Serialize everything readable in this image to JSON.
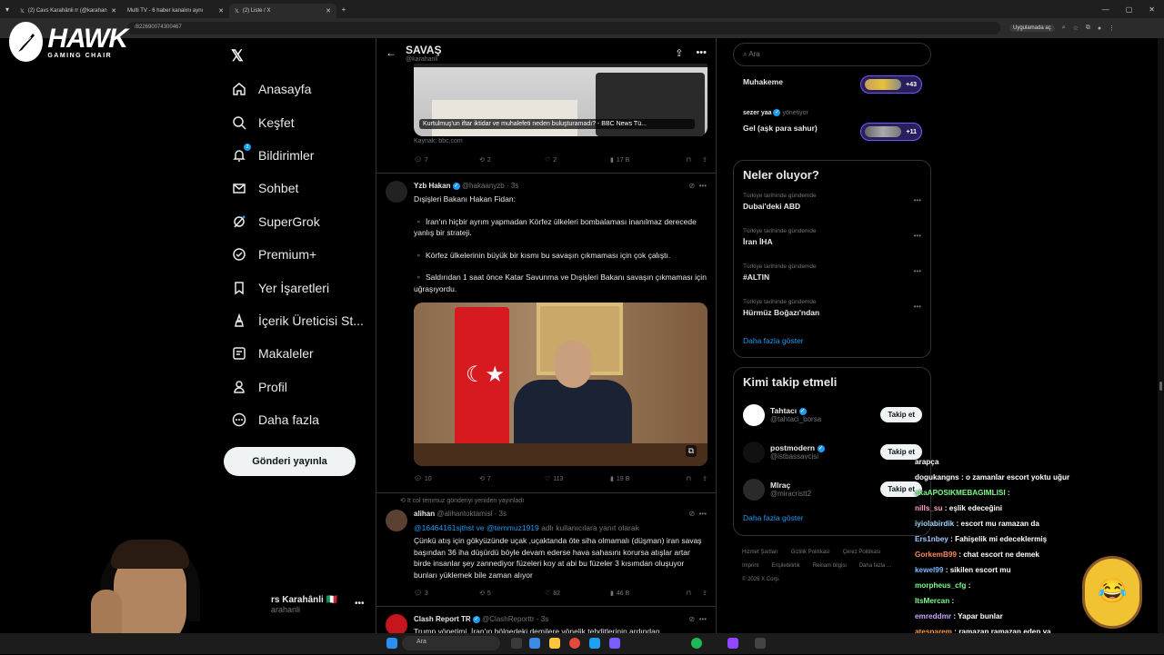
{
  "browser": {
    "tabs": [
      {
        "title": "(2) Cavs Karahânli rr (@karahan",
        "active": false
      },
      {
        "title": "Multi TV - 6 haber kanalını aynı",
        "active": false
      },
      {
        "title": "(2) Liste / X",
        "active": true
      }
    ],
    "url": "/822690074300467",
    "open_in_app": "Uygulamada aç"
  },
  "overlay_logo": {
    "title": "HAWK",
    "subtitle": "GAMING CHAIR"
  },
  "sidebar": {
    "items": [
      {
        "label": "Anasayfa",
        "icon": "home-icon"
      },
      {
        "label": "Keşfet",
        "icon": "search-icon"
      },
      {
        "label": "Bildirimler",
        "icon": "bell-icon",
        "badge": "2"
      },
      {
        "label": "Sohbet",
        "icon": "mail-icon"
      },
      {
        "label": "SuperGrok",
        "icon": "grok-icon"
      },
      {
        "label": "Premium+",
        "icon": "verified-icon"
      },
      {
        "label": "Yer İşaretleri",
        "icon": "bookmark-icon"
      },
      {
        "label": "İçerik Üreticisi St...",
        "icon": "creator-icon"
      },
      {
        "label": "Makaleler",
        "icon": "article-icon"
      },
      {
        "label": "Profil",
        "icon": "person-icon"
      },
      {
        "label": "Daha fazla",
        "icon": "more-circle-icon"
      }
    ],
    "post_button": "Gönderi yayınla",
    "profile_name": "rs Karahânli 🇮🇹",
    "profile_handle": "arahanli"
  },
  "feed": {
    "title": "SAVAŞ",
    "subtitle": "@karahanli",
    "card": {
      "caption": "Kurtulmuş'un iftar iktidar ve muhalefeti neden buluşturamadı? - BBC News Tü...",
      "source": "Kaynak: bbc.com",
      "replies": "7",
      "reposts": "2",
      "likes": "2",
      "views": "17 B"
    },
    "tweets": [
      {
        "name": "Yzb Hakan",
        "handle": "@hakaanyzb",
        "time": "3s",
        "lines": [
          "Dışişleri Bakanı Hakan Fidan:",
          "▪️ İran'ın hiçbir ayrım yapmadan Körfez ülkeleri bombalaması inanılmaz derecede yanlış bir strateji.",
          "▪️ Körfez ülkelerinin büyük bir kısmı bu savaşın çıkmaması için çok çalıştı.",
          "▪️ Saldırıdan 1 saat önce Katar Savunma ve Dışişleri Bakanı savaşın çıkmaması için uğraşıyordu."
        ],
        "replies": "10",
        "reposts": "7",
        "likes": "113",
        "views": "19 B"
      },
      {
        "repost_note": "It col temmuz gönderiyi yeniden yayınladı",
        "name": "alihan",
        "handle": "@alihantoktamisl",
        "time": "3s",
        "reply_to": "@16464161sjthst ve @temmuz1919",
        "reply_suffix": "adlı kullanıcılara yanıt olarak",
        "text": "Çünkü atış için gökyüzünde uçak ,uçaktanda öte siha olmamalı (düşman) iran savaş başından 36 iha düşürdü böyle devam ederse hava sahasını korursa atışlar artar birde insanlar şey zannediyor füzeleri koy at abi bu füzeler 3 kısımdan oluşuyor bunları yüklemek bile zaman alıyor",
        "replies": "3",
        "reposts": "5",
        "likes": "82",
        "views": "46 B"
      },
      {
        "name": "Clash Report TR",
        "handle": "@ClashReporttr",
        "time": "3s",
        "text": "Trump yönetimi, İran'ın bölgedeki demilere yönelik tehditlerinin ardından"
      }
    ]
  },
  "right": {
    "search_placeholder": "Ara",
    "spaces": [
      {
        "name": "Muhakeme",
        "count": "+43"
      },
      {
        "host": "sezer yaa",
        "host_role": "yönetiyor",
        "name": "Gel (aşk para sahur)",
        "count": "+11"
      }
    ],
    "trends_title": "Neler oluyor?",
    "trends": [
      {
        "context": "Türkiye tarihinde gündemde",
        "name": "Dubai'deki ABD"
      },
      {
        "context": "Türkiye tarihinde gündemde",
        "name": "İran İHA"
      },
      {
        "context": "Türkiye tarihinde gündemde",
        "name": "#ALTIN"
      },
      {
        "context": "Türkiye tarihinde gündemde",
        "name": "Hürmüz Boğazı'ndan"
      }
    ],
    "show_more": "Daha fazla göster",
    "who_title": "Kimi takip etmeli",
    "who": [
      {
        "name": "Tahtacı",
        "handle": "@tahtaci_borsa"
      },
      {
        "name": "postmodern",
        "handle": "@istbassavcisi"
      },
      {
        "name": "Mlraç",
        "handle": "@miracristt2"
      }
    ],
    "follow_label": "Takip et",
    "footer": [
      "Hizmet Şartları",
      "Gizlilik Politikası",
      "Çerez Politikası",
      "Imprint",
      "Erişilebilirlik",
      "Reklam bilgisi",
      "Daha fazla ...",
      "© 2026 X Corp."
    ]
  },
  "chat": [
    {
      "user": "",
      "msg": "arapça"
    },
    {
      "user": "dogukangns",
      "msg": ": o zamanlar escort yoktu uğur"
    },
    {
      "user": "akaAPOSIKMEBAGIMLISI",
      "msg": ":"
    },
    {
      "user": "nills_su",
      "msg": ": eşlik edeceğini"
    },
    {
      "user": "iyiolabirdik",
      "msg": ": escort mu ramazan da"
    },
    {
      "user": "Ers1nbey",
      "msg": ": Fahişelik mi edeceklermiş"
    },
    {
      "user": "GorkemB99",
      "msg": ": chat escort ne demek"
    },
    {
      "user": "kewel99",
      "msg": ": sikilen escort mu"
    },
    {
      "user": "morpheus_cfg",
      "msg": ":"
    },
    {
      "user": "ItsMercan",
      "msg": ":"
    },
    {
      "user": "emreddmr",
      "msg": ": Yapar bunlar"
    },
    {
      "user": "atesparem",
      "msg": ": ramazan ramazan edep ya"
    },
    {
      "user": "KerimmZ",
      "msg": ":"
    }
  ],
  "chat_colors": [
    "#ffffff",
    "#ffffff",
    "#7cfc8a",
    "#ff9ec8",
    "#9fd6ff",
    "#a7c7ff",
    "#ff8a5c",
    "#7ab8ff",
    "#7cfc8a",
    "#7cfc8a",
    "#c9a8ff",
    "#ff9a3c",
    "#ffd24d"
  ],
  "taskbar": {
    "search_placeholder": "Ara"
  }
}
